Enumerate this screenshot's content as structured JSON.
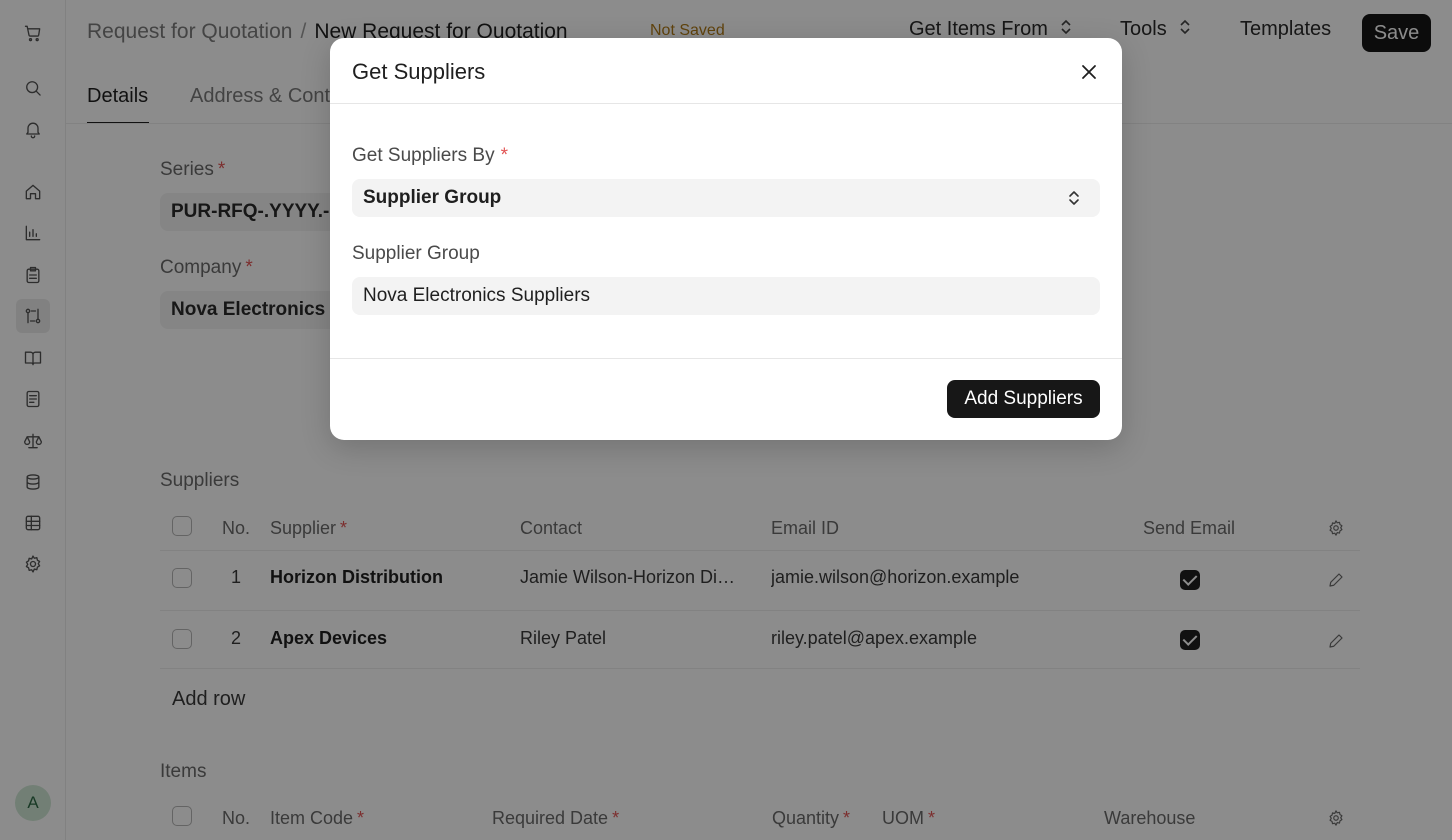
{
  "header": {
    "breadcrumb_parent": "Request for Quotation",
    "breadcrumb_sep": "/",
    "page_title": "New Request for Quotation",
    "status": "Not Saved",
    "get_items_label": "Get Items From",
    "tools_label": "Tools",
    "templates_label": "Templates",
    "save_label": "Save"
  },
  "tabs": [
    "Details",
    "Address & Contact"
  ],
  "form": {
    "series_label": "Series",
    "series_value": "PUR-RFQ-.YYYY.-",
    "company_label": "Company",
    "company_value": "Nova Electronics"
  },
  "suppliers": {
    "title": "Suppliers",
    "columns": [
      "No.",
      "Supplier",
      "Contact",
      "Email ID",
      "Send Email"
    ],
    "rows": [
      {
        "no": "1",
        "supplier": "Horizon Distribution",
        "contact": "Jamie Wilson-Horizon Distribution",
        "email": "jamie.wilson@horizon.example",
        "send_email": true
      },
      {
        "no": "2",
        "supplier": "Apex Devices",
        "contact": "Riley Patel",
        "email": "riley.patel@apex.example",
        "send_email": true
      }
    ],
    "add_row_label": "Add row"
  },
  "items": {
    "title": "Items",
    "columns": [
      "No.",
      "Item Code",
      "Required Date",
      "Quantity",
      "UOM",
      "Warehouse"
    ]
  },
  "user": {
    "avatar_initial": "A"
  },
  "modal": {
    "title": "Get Suppliers",
    "field1_label": "Get Suppliers By",
    "field1_value": "Supplier Group",
    "field2_label": "Supplier Group",
    "field2_value": "Nova Electronics Suppliers",
    "primary_label": "Add Suppliers"
  },
  "colors": {
    "primary": "#171717",
    "required": "#e25555",
    "status": "#b07b19"
  }
}
